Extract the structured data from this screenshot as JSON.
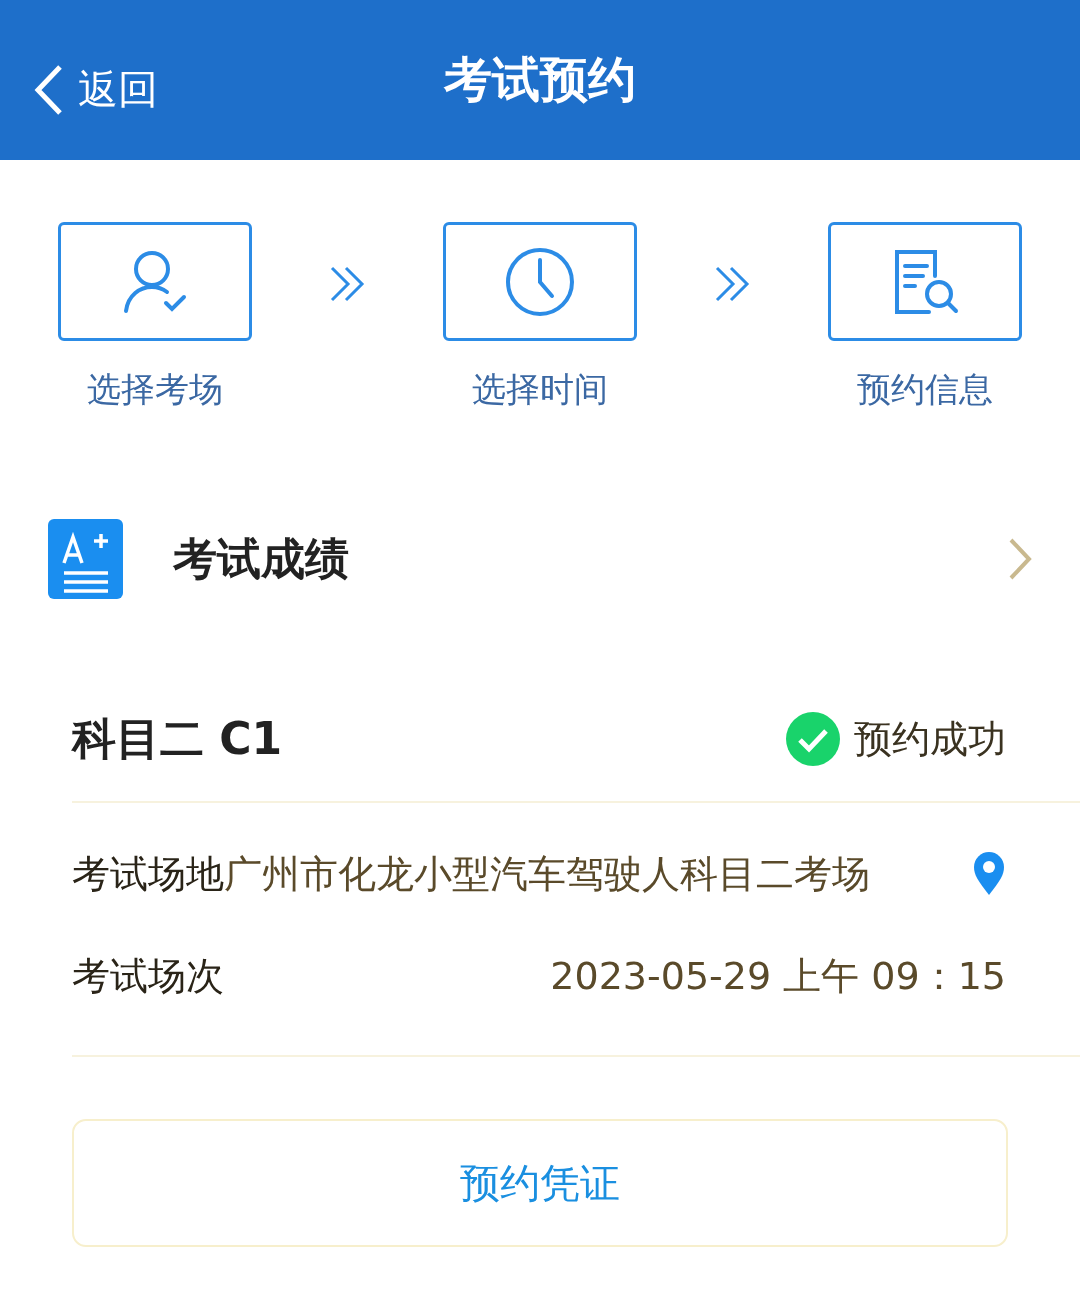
{
  "header": {
    "back": "返回",
    "title": "考试预约"
  },
  "steps": [
    {
      "kind": "person",
      "label": "选择考场"
    },
    {
      "kind": "clock",
      "label": "选择时间"
    },
    {
      "kind": "document",
      "label": "预约信息"
    }
  ],
  "score": {
    "label": "考试成绩"
  },
  "booking": {
    "subject": "科目二 C1",
    "status": "预约成功",
    "success": true,
    "rows": [
      {
        "kind": "location",
        "label": "考试场地",
        "value": "广州市化龙小型汽车驾驶人科目二考场"
      },
      {
        "kind": "time",
        "label": "考试场次",
        "value": "2023-05-29 上午 09：15"
      }
    ]
  },
  "button": "预约凭证"
}
